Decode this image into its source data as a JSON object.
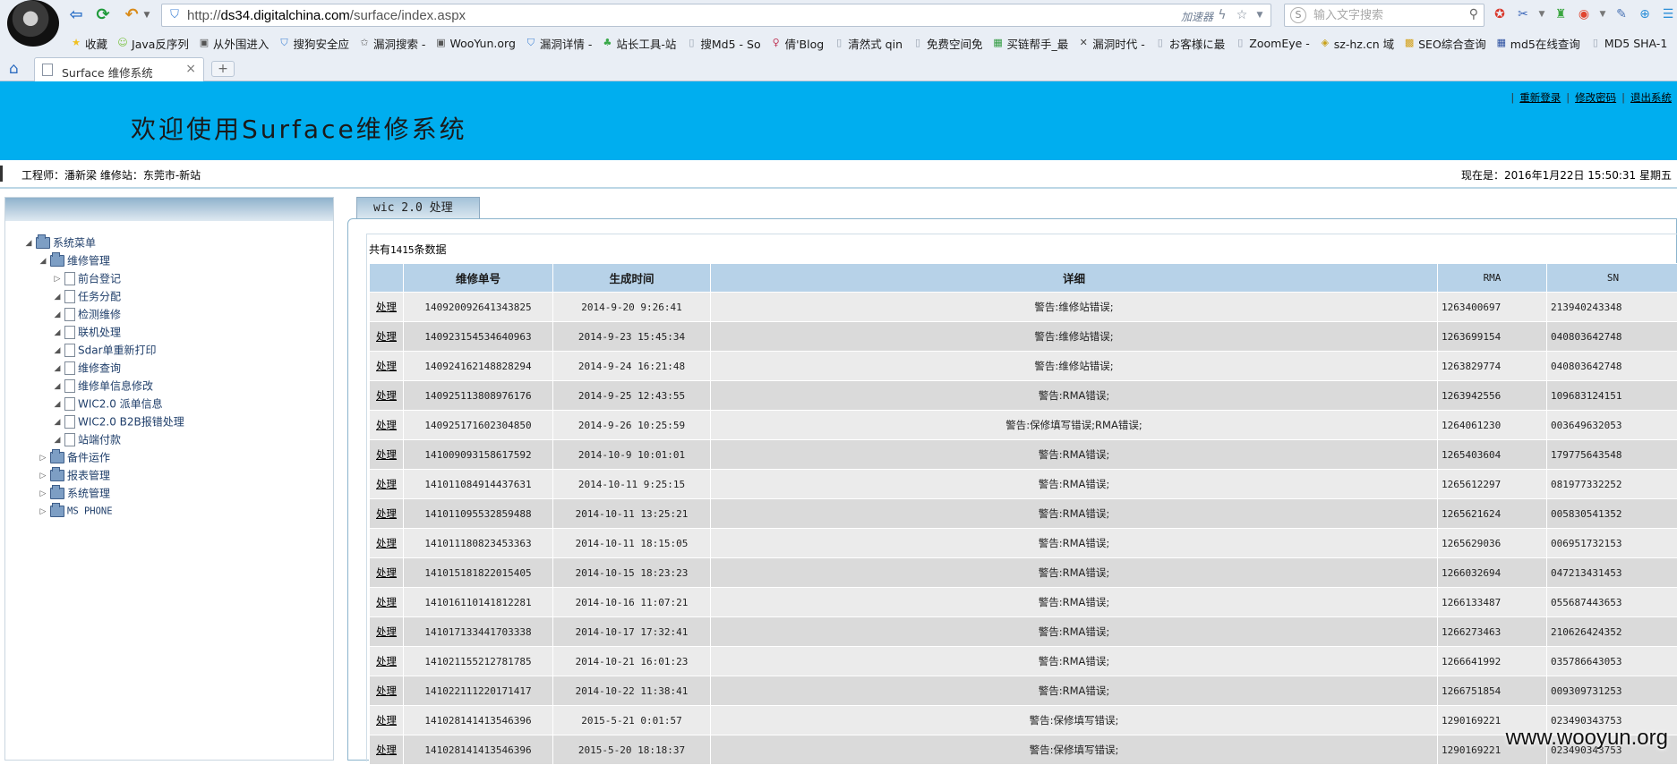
{
  "browser": {
    "address": {
      "scheme": "http://",
      "host": "ds34.digitalchina.com",
      "path": "/surface/index.aspx"
    },
    "accelerator_label": "加速器",
    "search_placeholder": "输入文字搜索",
    "bookmarks": [
      {
        "label": "收藏",
        "icon": "star-icon",
        "color": "#f0c020"
      },
      {
        "label": "Java反序列",
        "icon": "emoji-icon",
        "color": "#7cc242"
      },
      {
        "label": "从外围进入",
        "icon": "page-thumb-icon",
        "color": "#555555"
      },
      {
        "label": "搜狗安全应",
        "icon": "shield-icon",
        "color": "#3f82d4"
      },
      {
        "label": "漏洞搜索 -",
        "icon": "star-outline-icon",
        "color": "#666666"
      },
      {
        "label": "WooYun.org",
        "icon": "page-thumb-icon",
        "color": "#555555"
      },
      {
        "label": "漏洞详情 -",
        "icon": "shield-icon",
        "color": "#3f82d4"
      },
      {
        "label": "站长工具-站",
        "icon": "leaf-icon",
        "color": "#38a848"
      },
      {
        "label": "搜Md5 - So",
        "icon": "page-icon",
        "color": "#9aa4b2"
      },
      {
        "label": "倩'Blog",
        "icon": "portrait-icon",
        "color": "#c03a5a"
      },
      {
        "label": "清然式 qin",
        "icon": "page-icon",
        "color": "#9aa4b2"
      },
      {
        "label": "免费空间免",
        "icon": "page-icon",
        "color": "#9aa4b2"
      },
      {
        "label": "买链帮手_最",
        "icon": "grid-icon",
        "color": "#2f9a3f"
      },
      {
        "label": "漏洞时代 -",
        "icon": "cross-icon",
        "color": "#444444"
      },
      {
        "label": "お客様に最",
        "icon": "page-icon",
        "color": "#9aa4b2"
      },
      {
        "label": "ZoomEye -",
        "icon": "page-icon",
        "color": "#9aa4b2"
      },
      {
        "label": "sz-hz.cn 域",
        "icon": "seal-icon",
        "color": "#c8a018"
      },
      {
        "label": "SEO综合查询",
        "icon": "seo-icon",
        "color": "#d4a017"
      },
      {
        "label": "md5在线查询",
        "icon": "grid-icon",
        "color": "#2b4fa0"
      },
      {
        "label": "MD5 SHA-1",
        "icon": "page-icon",
        "color": "#9aa4b2"
      }
    ],
    "tab": {
      "title": "Surface 维修系统"
    }
  },
  "page": {
    "banner_title": "欢迎使用Surface维修系统",
    "top_links": [
      "重新登录",
      "修改密码",
      "退出系统"
    ],
    "engineer_text": "工程师：潘新梁   维修站：东莞市-新站",
    "clock_text": "现在是：2016年1月22日 15:50:31 星期五"
  },
  "sidebar": {
    "tree": [
      {
        "label": "系统菜单",
        "level": 0,
        "type": "folder",
        "toggle": "◢",
        "mono": false
      },
      {
        "label": "维修管理",
        "level": 1,
        "type": "folder",
        "toggle": "◢",
        "mono": false
      },
      {
        "label": "前台登记",
        "level": 2,
        "type": "doc",
        "toggle": "▷",
        "mono": false
      },
      {
        "label": "任务分配",
        "level": 2,
        "type": "doc",
        "toggle": "◢",
        "mono": false
      },
      {
        "label": "检测维修",
        "level": 2,
        "type": "doc",
        "toggle": "◢",
        "mono": false
      },
      {
        "label": "联机处理",
        "level": 2,
        "type": "doc",
        "toggle": "◢",
        "mono": false
      },
      {
        "label": "Sdar单重新打印",
        "level": 2,
        "type": "doc",
        "toggle": "◢",
        "mono": false
      },
      {
        "label": "维修查询",
        "level": 2,
        "type": "doc",
        "toggle": "◢",
        "mono": false
      },
      {
        "label": "维修单信息修改",
        "level": 2,
        "type": "doc",
        "toggle": "◢",
        "mono": false
      },
      {
        "label": "WIC2.0 派单信息",
        "level": 2,
        "type": "doc",
        "toggle": "◢",
        "mono": false
      },
      {
        "label": "WIC2.0 B2B报错处理",
        "level": 2,
        "type": "doc",
        "toggle": "◢",
        "mono": false
      },
      {
        "label": "站端付款",
        "level": 2,
        "type": "doc",
        "toggle": "◢",
        "mono": false
      },
      {
        "label": "备件运作",
        "level": 1,
        "type": "folder",
        "toggle": "▷",
        "mono": false
      },
      {
        "label": "报表管理",
        "level": 1,
        "type": "folder",
        "toggle": "▷",
        "mono": false
      },
      {
        "label": "系统管理",
        "level": 1,
        "type": "folder",
        "toggle": "▷",
        "mono": false
      },
      {
        "label": "MS PHONE",
        "level": 1,
        "type": "folder",
        "toggle": "▷",
        "mono": true
      }
    ]
  },
  "main": {
    "tab_label": "wic 2.0 处理",
    "count_prefix": "共有",
    "count_value": "1415",
    "count_suffix": "条数据",
    "columns": [
      "",
      "维修单号",
      "生成时间",
      "详细",
      "RMA",
      "SN"
    ],
    "action_label": "处理",
    "rows": [
      {
        "order": "140920092641343825",
        "time": "2014-9-20 9:26:41",
        "detail": "警告:维修站错误;",
        "rma": "1263400697",
        "sn": "213940243348"
      },
      {
        "order": "140923154534640963",
        "time": "2014-9-23 15:45:34",
        "detail": "警告:维修站错误;",
        "rma": "1263699154",
        "sn": "040803642748"
      },
      {
        "order": "140924162148828294",
        "time": "2014-9-24 16:21:48",
        "detail": "警告:维修站错误;",
        "rma": "1263829774",
        "sn": "040803642748"
      },
      {
        "order": "140925113808976176",
        "time": "2014-9-25 12:43:55",
        "detail": "警告:RMA错误;",
        "rma": "1263942556",
        "sn": "109683124151"
      },
      {
        "order": "140925171602304850",
        "time": "2014-9-26 10:25:59",
        "detail": "警告:保修填写错误;RMA错误;",
        "rma": "1264061230",
        "sn": "003649632053"
      },
      {
        "order": "141009093158617592",
        "time": "2014-10-9 10:01:01",
        "detail": "警告:RMA错误;",
        "rma": "1265403604",
        "sn": "179775643548"
      },
      {
        "order": "141011084914437631",
        "time": "2014-10-11 9:25:15",
        "detail": "警告:RMA错误;",
        "rma": "1265612297",
        "sn": "081977332252"
      },
      {
        "order": "141011095532859488",
        "time": "2014-10-11 13:25:21",
        "detail": "警告:RMA错误;",
        "rma": "1265621624",
        "sn": "005830541352"
      },
      {
        "order": "141011180823453363",
        "time": "2014-10-11 18:15:05",
        "detail": "警告:RMA错误;",
        "rma": "1265629036",
        "sn": "006951732153"
      },
      {
        "order": "141015181822015405",
        "time": "2014-10-15 18:23:23",
        "detail": "警告:RMA错误;",
        "rma": "1266032694",
        "sn": "047213431453"
      },
      {
        "order": "141016110141812281",
        "time": "2014-10-16 11:07:21",
        "detail": "警告:RMA错误;",
        "rma": "1266133487",
        "sn": "055687443653"
      },
      {
        "order": "141017133441703338",
        "time": "2014-10-17 17:32:41",
        "detail": "警告:RMA错误;",
        "rma": "1266273463",
        "sn": "210626424352"
      },
      {
        "order": "141021155212781785",
        "time": "2014-10-21 16:01:23",
        "detail": "警告:RMA错误;",
        "rma": "1266641992",
        "sn": "035786643053"
      },
      {
        "order": "141022111220171417",
        "time": "2014-10-22 11:38:41",
        "detail": "警告:RMA错误;",
        "rma": "1266751854",
        "sn": "009309731253"
      },
      {
        "order": "141028141413546396",
        "time": "2015-5-21 0:01:57",
        "detail": "警告:保修填写错误;",
        "rma": "1290169221",
        "sn": "023490343753"
      },
      {
        "order": "141028141413546396",
        "time": "2015-5-20 18:18:37",
        "detail": "警告:保修填写错误;",
        "rma": "1290169221",
        "sn": "023490343753"
      }
    ]
  },
  "watermark": "www.wooyun.org"
}
